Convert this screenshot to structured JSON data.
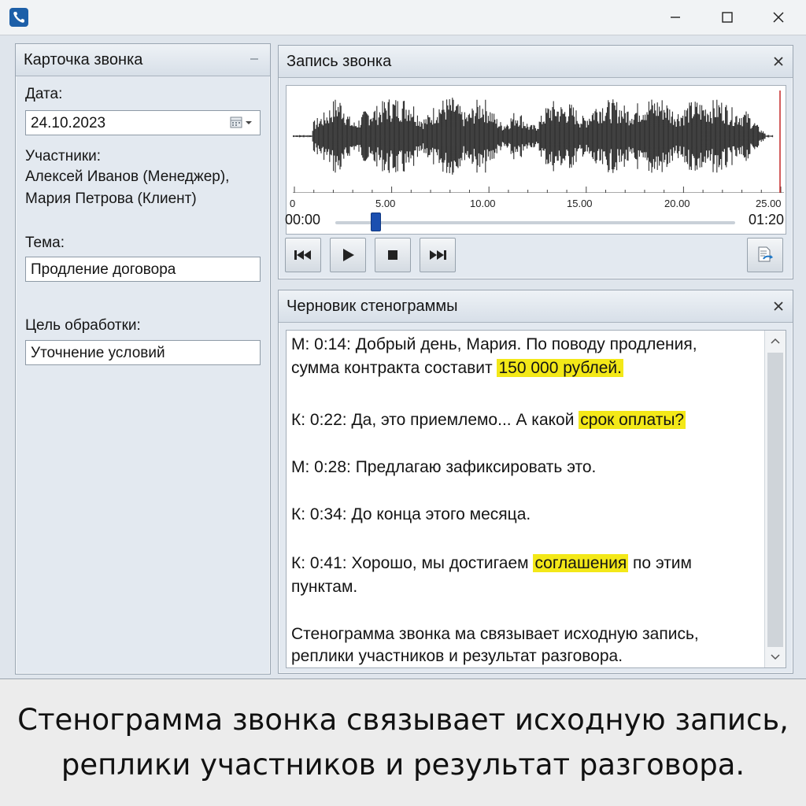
{
  "window": {
    "controls": {
      "minimize_icon": "minimize-icon",
      "maximize_icon": "maximize-icon",
      "close_icon": "close-icon"
    }
  },
  "call_card": {
    "title": "Карточка звонка",
    "date_label": "Дата:",
    "date_value": "24.10.2023",
    "participants_label": "Участники:",
    "participants": [
      "Алексей Иванов (Менеджер),",
      "Мария Петрова (Клиент)"
    ],
    "topic_label": "Тема:",
    "topic_value": "Продление договора",
    "goal_label": "Цель обработки:",
    "goal_value": "Уточнение условий"
  },
  "recording": {
    "title": "Запись звонка",
    "timeline_ticks": [
      "0",
      "5.00",
      "10.00",
      "15.00",
      "20.00",
      "25.00"
    ],
    "current_time": "00:00",
    "total_time": "01:20",
    "playback_progress": 0.1,
    "buttons": {
      "rewind": "rewind-icon",
      "play": "play-icon",
      "stop": "stop-icon",
      "fast_forward": "fast-forward-icon",
      "export": "export-document-icon"
    }
  },
  "transcript": {
    "title": "Черновик стенограммы",
    "highlight_color": "#f3e818",
    "lines": [
      {
        "pre": "М: 0:14: Добрый день, Мария. По поводу продления,",
        "hl": "",
        "post": ""
      },
      {
        "pre": "сумма контракта составит ",
        "hl": "150 000 рублей.",
        "post": ""
      },
      {
        "pre": "К: 0:22: Да, это приемлемо... А какой ",
        "hl": "срок оплаты?",
        "post": ""
      },
      {
        "pre": "М: 0:28: Предлагаю зафиксировать это.",
        "hl": "",
        "post": ""
      },
      {
        "pre": "К: 0:34: До конца этого месяца.",
        "hl": "",
        "post": ""
      },
      {
        "pre": "К: 0:41: Хорошо, мы достигаем ",
        "hl": "соглашения",
        "post": " по этим"
      },
      {
        "pre": "пунктам.",
        "hl": "",
        "post": ""
      },
      {
        "pre": "Стенограмма звонка ма связывает исходную запись,",
        "hl": "",
        "post": ""
      },
      {
        "pre": "реплики участников и результат разговора.",
        "hl": "",
        "post": ""
      }
    ]
  },
  "caption": {
    "line1": "Стенограмма звонка связывает исходную запись,",
    "line2": "реплики участников и результат разговора."
  }
}
